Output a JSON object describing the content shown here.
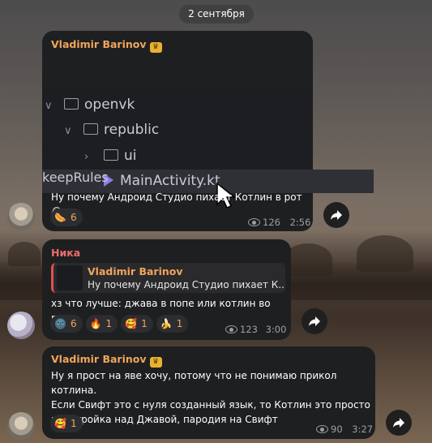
{
  "date_pill": "2 сентября",
  "messages": [
    {
      "sender": "Vladimir Barinov",
      "code_rows": [
        "openvk",
        "republic",
        "ui",
        "MainActivity.kt"
      ],
      "code_bottom": "keepRules",
      "text": "Ну почему Андроид Студио пихает Котлин в рот 😭",
      "reactions": [
        {
          "emoji": "🌭",
          "count": "6"
        }
      ],
      "views": "126",
      "time": "2:56"
    },
    {
      "sender": "Ника",
      "reply": {
        "sender": "Vladimir Barinov",
        "text": "Ну почему Андроид Студио пихает К..."
      },
      "text": "хз что лучше: джава в попе или котлин во рту...",
      "reactions": [
        {
          "emoji": "🌚",
          "count": "6"
        },
        {
          "emoji": "🔥",
          "count": "1"
        },
        {
          "emoji": "🥰",
          "count": "1"
        },
        {
          "emoji": "🍌",
          "count": "1"
        }
      ],
      "views": "123",
      "time": "3:00"
    },
    {
      "sender": "Vladimir Barinov",
      "text_lines": [
        "Ну я прост на яве хочу, потому что не понимаю прикол котлина.",
        "Если Свифт это с нуля созданный язык, то Котлин это просто",
        "надстройка над Джавой, пародия на Свифт"
      ],
      "reactions": [
        {
          "emoji": "🥰",
          "count": "1"
        }
      ],
      "views": "90",
      "time": "3:27"
    }
  ],
  "colors": {
    "sender_orange": "#f0a55c",
    "sender_red": "#ee6c6c",
    "bubble": "#1e1f20"
  }
}
